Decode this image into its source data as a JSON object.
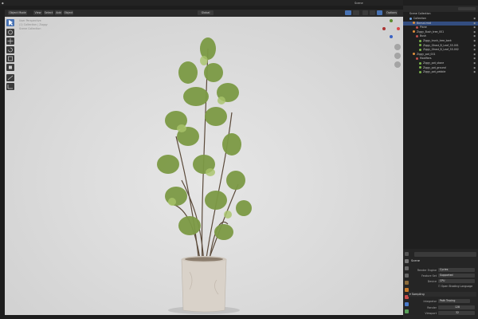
{
  "topbar": {
    "scene": "Scene",
    "view_layer": "View Layer"
  },
  "viewport_header": {
    "mode": "Object Mode",
    "menus": [
      "View",
      "Select",
      "Add",
      "Object"
    ],
    "transform": "Global",
    "options": "Options"
  },
  "viewport": {
    "overlay_lines": [
      "User Perspective",
      "(1) Collection | Zoggy",
      "Scene Collection"
    ]
  },
  "outliner": {
    "title": "Scene Collection",
    "rows": [
      {
        "label": "Collection",
        "indent": 1
      },
      {
        "label": "Bonsai.mat",
        "indent": 2,
        "selected": true
      },
      {
        "label": "Plane",
        "indent": 3
      },
      {
        "label": "Ziggy_Bush_tree_001",
        "indent": 2
      },
      {
        "label": "Bush",
        "indent": 3
      },
      {
        "label": "Ziggy_trunk_tree_bark",
        "indent": 4
      },
      {
        "label": "Ziggy_Ghost_B_Leaf_SS.001",
        "indent": 4
      },
      {
        "label": "Ziggy_Ghost_B_Leaf_SS.002",
        "indent": 4
      },
      {
        "label": "Ziggy_pot_001",
        "indent": 2
      },
      {
        "label": "Modifiers",
        "indent": 3
      },
      {
        "label": "Ziggy_pot_stone",
        "indent": 4
      },
      {
        "label": "Ziggy_pot_ground",
        "indent": 4
      },
      {
        "label": "Ziggy_pot_pebble",
        "indent": 4
      }
    ]
  },
  "properties": {
    "header": "Scene",
    "render_engine_label": "Render Engine",
    "render_engine_value": "Cycles",
    "feature_set_label": "Feature Set",
    "feature_set_value": "Supported",
    "device_label": "Device",
    "device_value": "CPU",
    "osl_label": "Open Shading Language",
    "sampling_label": "Sampling",
    "integrator_label": "Integrator",
    "integrator_value": "Path Tracing",
    "render_label": "Render",
    "render_value": "128",
    "viewport_label": "Viewport",
    "viewport_value": "32"
  },
  "colors": {
    "accent": "#4772b3",
    "selected_row": "#334d80",
    "viewport_bg": "#dcdcdc"
  }
}
